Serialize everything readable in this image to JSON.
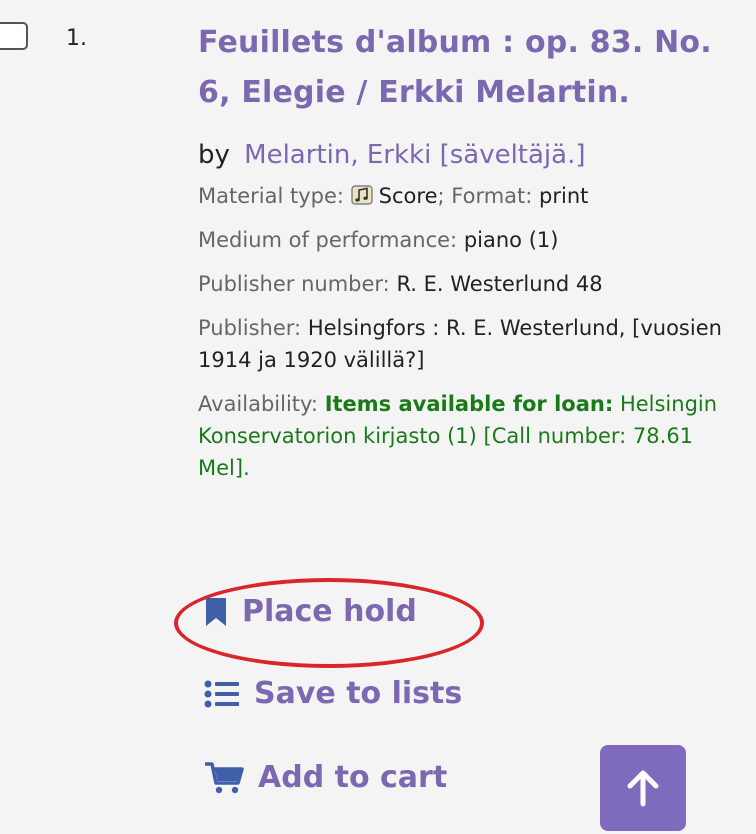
{
  "result": {
    "number": "1.",
    "title": "Feuillets d'album : op. 83. No. 6, Elegie / Erkki Melartin.",
    "by_label": "by",
    "author": "Melartin, Erkki [säveltäjä.]",
    "material_type_label": "Material type:",
    "material_type_icon": "score-icon",
    "material_type_value": "Score",
    "format_label": "Format:",
    "format_value": "print",
    "medium_label": "Medium of performance:",
    "medium_value": "piano (1)",
    "publisher_number_label": "Publisher number:",
    "publisher_number_value": "R. E. Westerlund 48",
    "publisher_label": "Publisher:",
    "publisher_value": "Helsingfors : R. E. Westerlund, [vuosien 1914 ja 1920 välillä?]",
    "availability_label": "Availability:",
    "availability_status": "Items available for loan:",
    "availability_detail": "Helsingin Konservatorion kirjasto (1) [Call number: 78.61 Mel]."
  },
  "actions": {
    "place_hold": "Place hold",
    "save_to_lists": "Save to lists",
    "add_to_cart": "Add to cart"
  },
  "icons": {
    "hold": "bookmark-icon",
    "lists": "list-icon",
    "cart": "cart-icon",
    "top": "arrow-up-icon"
  },
  "colors": {
    "accent": "#7b68b0",
    "available": "#1a7a1a",
    "highlight": "#d8262a"
  }
}
